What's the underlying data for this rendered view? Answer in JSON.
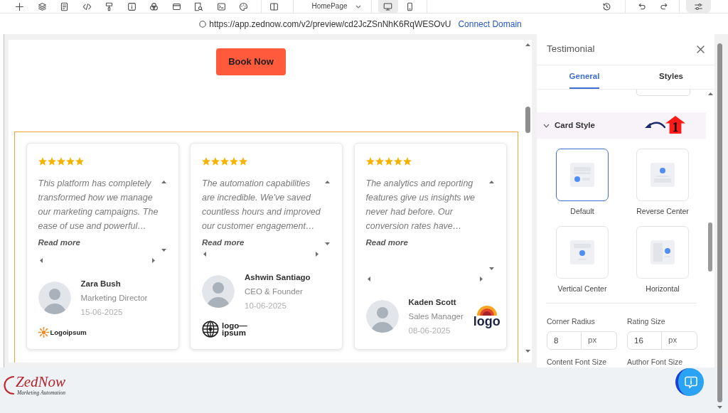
{
  "toolbar": {
    "page_selector": {
      "value": "HomePage"
    },
    "devices": [
      {
        "kind": "desktop",
        "selected": true
      },
      {
        "kind": "mobile",
        "selected": false
      }
    ],
    "settings": {
      "selected": true
    }
  },
  "address_bar": {
    "url": "https://app.zednow.com/v2/preview/cd2JcZSnNhK6RqWESOvU",
    "link": "Connect Domain"
  },
  "canvas": {
    "cta_button": {
      "label": "Book Now"
    },
    "testimonials": [
      {
        "stars": 5,
        "quote": "This platform has completely transformed how we manage our marketing campaigns. The ease of use and powerful…",
        "read_more": "Read more",
        "author": {
          "name": "Zara Bush",
          "role": "Marketing Director",
          "date": "15-06-2025"
        },
        "logo": {
          "kind": "sun",
          "lines": [
            "Logoipsum"
          ]
        }
      },
      {
        "stars": 5,
        "quote": "The automation capabilities are incredible. We've saved countless hours and improved our customer engagement…",
        "read_more": "Read more",
        "author": {
          "name": "Ashwin Santiago",
          "role": "CEO & Founder",
          "date": "10-06-2025"
        },
        "logo": {
          "kind": "globe",
          "lines": [
            "logo—",
            "ipsum"
          ]
        }
      },
      {
        "stars": 5,
        "quote": "The analytics and reporting features give us insights we never had before. Our conversion rates have…",
        "read_more": "Read more",
        "author": {
          "name": "Kaden Scott",
          "role": "Sales Manager",
          "date": "08-06-2025"
        },
        "logo": {
          "kind": "arch",
          "lines": [
            "logo"
          ]
        }
      }
    ]
  },
  "panel": {
    "title": "Testimonial",
    "tabs": [
      {
        "label": "General",
        "selected": true
      },
      {
        "label": "Styles",
        "selected": false
      }
    ],
    "section": {
      "title": "Card Style",
      "expanded": true,
      "annotation": {
        "text": "1"
      },
      "options": [
        {
          "kind": "default",
          "label": "Default",
          "selected": true
        },
        {
          "kind": "reverse-center",
          "label": "Reverse Center",
          "selected": false
        },
        {
          "kind": "vertical-center",
          "label": "Vertical Center",
          "selected": false
        },
        {
          "kind": "horizontal",
          "label": "Horizontal",
          "selected": false
        }
      ]
    },
    "fields": [
      {
        "label": "Corner Radius",
        "value": "8",
        "unit": "px"
      },
      {
        "label": "Rating Size",
        "value": "16",
        "unit": "px"
      },
      {
        "label": "Content Font Size"
      },
      {
        "label": "Author Font Size"
      }
    ]
  },
  "footer": {
    "brand": {
      "name": "ZedNow",
      "tagline": "Marketing Automation"
    }
  }
}
